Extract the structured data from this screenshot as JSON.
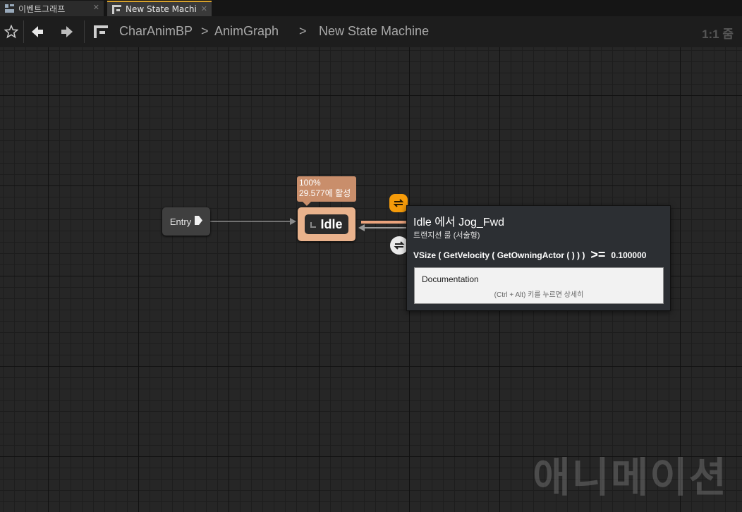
{
  "tabs": [
    {
      "label": "이벤트그래프",
      "icon": "event-graph-icon"
    },
    {
      "label": "New State Machine",
      "icon": "state-machine-icon"
    }
  ],
  "breadcrumb": {
    "items": [
      "CharAnimBP",
      "AnimGraph",
      "New State Machine"
    ],
    "separator": ">"
  },
  "zoom_label": "1:1 줌",
  "nodes": {
    "entry": {
      "label": "Entry"
    },
    "idle": {
      "title": "Idle",
      "bubble_percent": "100%",
      "bubble_active": "29.577에 활성"
    }
  },
  "tooltip": {
    "title": "Idle 에서 Jog_Fwd",
    "subtitle": "트랜지션 룰 (서술형)",
    "expr_left": "VSize ( GetVelocity ( GetOwningActor ( ) ) )",
    "expr_op": ">=",
    "expr_value": "0.100000",
    "doc_title": "Documentation",
    "doc_hint": "(Ctrl + Alt) 키를 누르면 상세히"
  },
  "watermark": "애니메이션",
  "colors": {
    "tab_active_accent": "#d7a12a",
    "state_active": "#e9b28c",
    "transition_active": "#f59b0a"
  }
}
